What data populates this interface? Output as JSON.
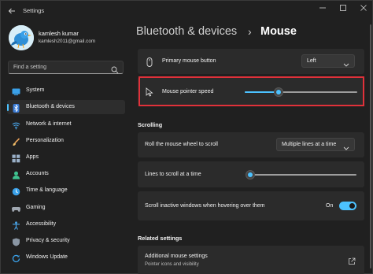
{
  "window": {
    "title": "Settings",
    "back_icon": "back-arrow-icon",
    "controls": [
      "minimize-icon",
      "maximize-icon",
      "close-icon"
    ]
  },
  "profile": {
    "name": "kamlesh kumar",
    "email": "kamlesh2011@gmail.com",
    "avatar_icon": "bird-avatar-icon"
  },
  "search": {
    "placeholder": "Find a setting",
    "icon": "search-icon"
  },
  "sidebar": {
    "items": [
      {
        "label": "System",
        "icon": "system-display-icon",
        "active": false
      },
      {
        "label": "Bluetooth & devices",
        "icon": "bluetooth-icon",
        "active": true
      },
      {
        "label": "Network & internet",
        "icon": "wifi-icon",
        "active": false
      },
      {
        "label": "Personalization",
        "icon": "brush-icon",
        "active": false
      },
      {
        "label": "Apps",
        "icon": "apps-icon",
        "active": false
      },
      {
        "label": "Accounts",
        "icon": "person-icon",
        "active": false
      },
      {
        "label": "Time & language",
        "icon": "globe-clock-icon",
        "active": false
      },
      {
        "label": "Gaming",
        "icon": "gamepad-icon",
        "active": false
      },
      {
        "label": "Accessibility",
        "icon": "accessibility-icon",
        "active": false
      },
      {
        "label": "Privacy & security",
        "icon": "shield-icon",
        "active": false
      },
      {
        "label": "Windows Update",
        "icon": "update-icon",
        "active": false
      }
    ]
  },
  "breadcrumb": {
    "parent": "Bluetooth & devices",
    "separator": "›",
    "current": "Mouse"
  },
  "main": {
    "primary_button": {
      "label": "Primary mouse button",
      "value": "Left",
      "icon": "mouse-icon"
    },
    "pointer_speed": {
      "label": "Mouse pointer speed",
      "value_fraction": 0.3,
      "icon": "cursor-pointer-icon"
    },
    "scrolling": {
      "title": "Scrolling",
      "roll_wheel": {
        "label": "Roll the mouse wheel to scroll",
        "value": "Multiple lines at a time"
      },
      "lines_to_scroll": {
        "label": "Lines to scroll at a time",
        "value_fraction": 0.02
      },
      "scroll_inactive": {
        "label": "Scroll inactive windows when hovering over them",
        "state_text": "On",
        "on": true
      }
    },
    "related": {
      "title": "Related settings",
      "additional": {
        "label": "Additional mouse settings",
        "sublabel": "Pointer icons and visibility",
        "icon": "external-link-icon"
      }
    }
  },
  "colors": {
    "accent": "#4cc2ff",
    "highlight_box": "#e0313a",
    "background": "#202020",
    "card": "#2b2b2b"
  }
}
